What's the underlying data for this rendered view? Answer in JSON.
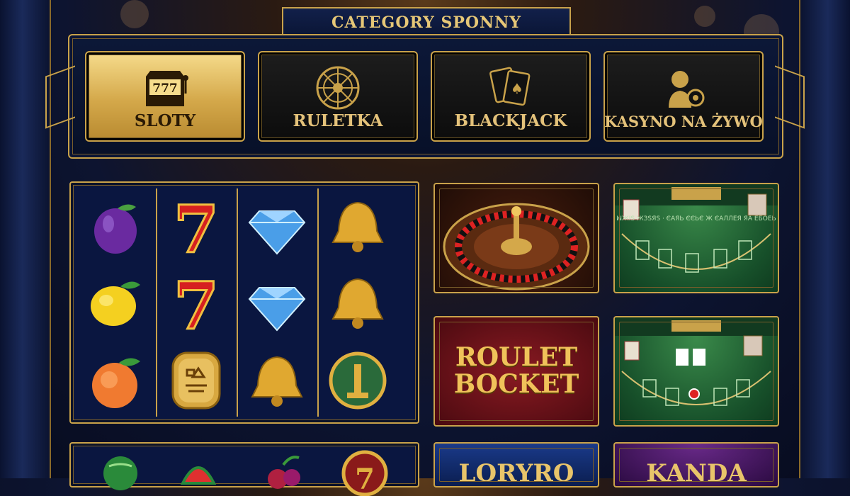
{
  "header": {
    "title": "CATEGORY SPONNY"
  },
  "tabs": [
    {
      "label": "SLOTY",
      "icon": "slot-machine-icon",
      "active": true
    },
    {
      "label": "RULETKA",
      "icon": "roulette-wheel-icon",
      "active": false
    },
    {
      "label": "BLACKJACK",
      "icon": "playing-cards-icon",
      "active": false
    },
    {
      "label": "KASYNO NA ŻYWO",
      "icon": "live-dealer-icon",
      "active": false
    }
  ],
  "slot_reels": [
    [
      "plum",
      "lemon",
      "peach"
    ],
    [
      "seven",
      "seven",
      "hieroglyph-plaque"
    ],
    [
      "diamond",
      "diamond",
      "bell"
    ],
    [
      "bell",
      "bell",
      "egyptian-coin"
    ]
  ],
  "slot_row2": [
    "watermelon",
    "watermelon",
    "cherries",
    "seven-coin"
  ],
  "game_tiles": {
    "roulette_wheel": {
      "icon": "roulette-wheel"
    },
    "blackjack_1": {
      "felt_text": "ꟽЖІЅ ЖЗЅЯЅ · ЄАЯЬ ЄЄЬЄ\nЖ ЄАЛЛЕЯ ЯА ЕБОЕЬ"
    },
    "roulette_text": {
      "line1": "ROULET",
      "line2": "BOCKET"
    },
    "blackjack_2": {
      "felt_text": ""
    },
    "loryro": {
      "text": "LORYRO"
    },
    "kanda": {
      "text": "KANDA"
    }
  },
  "colors": {
    "gold": "#c9a24a",
    "navy": "#0a1640",
    "active_tab": "#d4a84a"
  }
}
